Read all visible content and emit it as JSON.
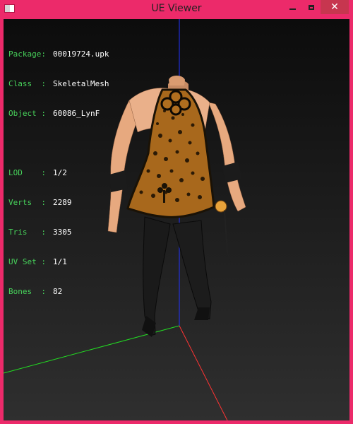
{
  "window": {
    "title": "UE Viewer",
    "icon": "app-icon",
    "controls": {
      "minimize": "minimize-icon",
      "maximize": "maximize-icon",
      "close": "close-icon"
    },
    "frame_color": "#ec2a6a",
    "close_color": "#c7364f"
  },
  "info": {
    "package": {
      "label": "Package:",
      "value": "00019724.upk"
    },
    "class": {
      "label": "Class  :",
      "value": "SkeletalMesh"
    },
    "object": {
      "label": "Object :",
      "value": "60086_LynF"
    },
    "lod": {
      "label": "LOD    :",
      "value": "1/2"
    },
    "verts": {
      "label": "Verts  :",
      "value": "2289"
    },
    "tris": {
      "label": "Tris   :",
      "value": "3305"
    },
    "uvset": {
      "label": "UV Set :",
      "value": "1/1"
    },
    "bones": {
      "label": "Bones  :",
      "value": "82"
    }
  },
  "colors": {
    "label": "#47d35b",
    "value": "#ffffff",
    "axis_x": "#ff3333",
    "axis_y": "#22dd22",
    "axis_z": "#2233ff"
  }
}
